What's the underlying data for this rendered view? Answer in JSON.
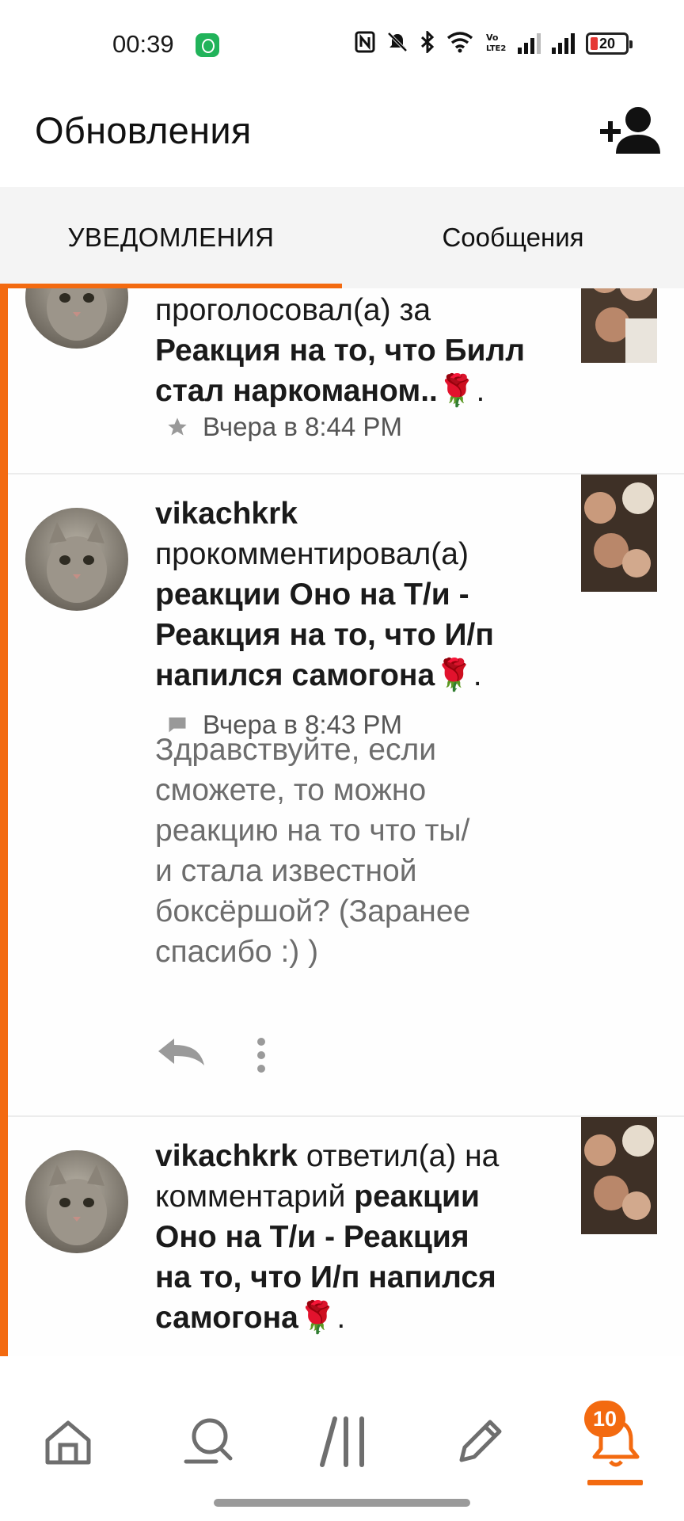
{
  "status_bar": {
    "time": "00:39",
    "battery_level": "20",
    "icons": [
      "app-notification-icon",
      "nfc-icon",
      "mute-icon",
      "bluetooth-icon",
      "wifi-icon",
      "volte-icon",
      "signal-icon",
      "signal-icon",
      "battery-icon"
    ],
    "volte_label": "Vo\nLTE2"
  },
  "header": {
    "title": "Обновления",
    "add_user_icon": "add-user-icon"
  },
  "tabs": [
    {
      "label": "УВЕДОМЛЕНИЯ",
      "active": true
    },
    {
      "label": "Сообщения",
      "active": false
    }
  ],
  "notifications": [
    {
      "line1": "проголосовал(а) за",
      "title_part1": "Реакция на то, что Билл",
      "title_part2": "стал наркоманом..",
      "emoji": "🌹",
      "suffix": ".",
      "meta_icon": "star-icon",
      "timestamp": "Вчера в 8:44 PM"
    },
    {
      "user": "vikachkrk",
      "action": "прокомментировал(а)",
      "title_part1": "реакции Оно на Т/и -",
      "title_part2": "Реакция на то, что И/п",
      "title_part3": "напился самогона",
      "emoji": "🌹",
      "suffix": ".",
      "meta_icon": "comment-icon",
      "timestamp": "Вчера в 8:43 PM",
      "comment_lines": [
        "Здравствуйте, если",
        "сможете, то можно",
        "реакцию на то что ты/",
        "и стала известной",
        "боксёршой? (Заранее",
        "спасибо :)  )"
      ],
      "reply_icon": "reply-icon",
      "more_icon": "more-vertical-icon"
    },
    {
      "user": "vikachkrk",
      "action_a": " ответил(а) на",
      "action_b": "комментарий ",
      "title_part1": "реакции",
      "title_part2": "Оно на Т/и - Реакция",
      "title_part3": "на то, что И/п напился",
      "title_part4": "самогона",
      "emoji": "🌹",
      "suffix": "."
    }
  ],
  "bottom_nav": {
    "items": [
      "home-icon",
      "search-icon",
      "library-icon",
      "write-icon",
      "notifications-bell-icon"
    ],
    "badge": "10",
    "active": "notifications-bell-icon"
  },
  "colors": {
    "accent": "#f36a10",
    "tab_bg": "#f4f4f4",
    "meta_text": "#555555",
    "comment_text": "#6d6d6d"
  }
}
